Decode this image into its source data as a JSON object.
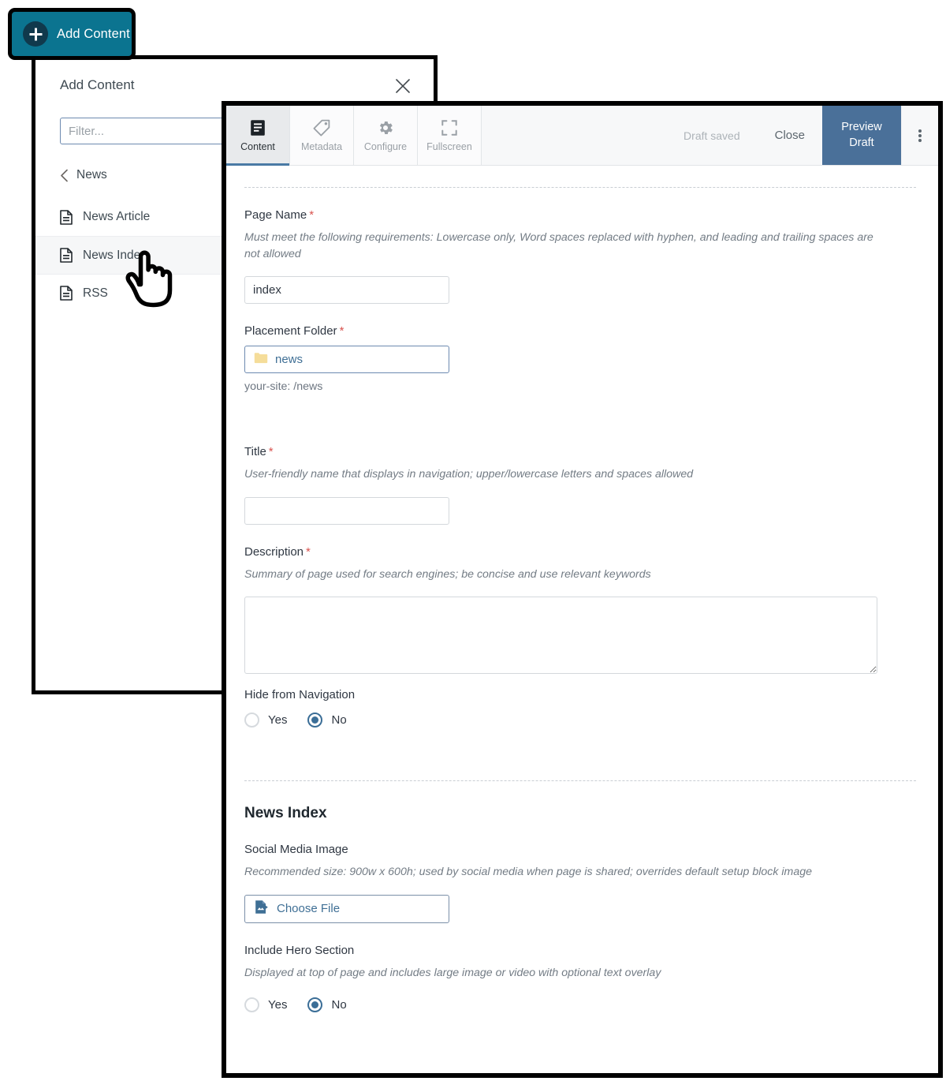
{
  "add_content_button": {
    "label": "Add Content",
    "icon": "plus-circle-icon",
    "background": "#0b7490",
    "icon_background": "#10394c"
  },
  "add_content_dialog": {
    "title": "Add Content",
    "close_icon": "close-icon",
    "filter": {
      "placeholder": "Filter...",
      "value": ""
    },
    "breadcrumb": {
      "back_icon": "chevron-left-icon",
      "label": "News"
    },
    "items": [
      {
        "label": "News Article",
        "icon": "document-icon",
        "selected": false
      },
      {
        "label": "News Index",
        "icon": "document-icon",
        "selected": true
      },
      {
        "label": "RSS",
        "icon": "document-icon",
        "selected": false
      }
    ]
  },
  "cursor": {
    "icon": "pointing-hand-cursor"
  },
  "editor": {
    "tabs": [
      {
        "label": "Content",
        "icon": "content-document-icon",
        "active": true
      },
      {
        "label": "Metadata",
        "icon": "tag-icon",
        "active": false
      },
      {
        "label": "Configure",
        "icon": "gear-icon",
        "active": false
      },
      {
        "label": "Fullscreen",
        "icon": "fullscreen-icon",
        "active": false
      }
    ],
    "status_text": "Draft saved",
    "close_label": "Close",
    "preview_label": "Preview Draft",
    "preview_color": "#4a7099",
    "kebab_icon": "more-vertical-icon",
    "form": {
      "page_name": {
        "label": "Page Name",
        "required": true,
        "help": "Must meet the following requirements: Lowercase only, Word spaces replaced with hyphen, and leading and trailing spaces are not allowed",
        "value": "index",
        "placeholder": ""
      },
      "placement_folder": {
        "label": "Placement Folder",
        "required": true,
        "icon": "folder-icon",
        "value": "news",
        "path_hint": "your-site: /news"
      },
      "title": {
        "label": "Title",
        "required": true,
        "help": "User-friendly name that displays in navigation; upper/lowercase letters and spaces allowed",
        "value": "",
        "placeholder": ""
      },
      "description": {
        "label": "Description",
        "required": true,
        "help": "Summary of page used for search engines; be concise and use relevant keywords",
        "value": "",
        "placeholder": ""
      },
      "hide_from_navigation": {
        "label": "Hide from Navigation",
        "options": [
          "Yes",
          "No"
        ],
        "selected": "No"
      },
      "section_heading": "News Index",
      "social_media_image": {
        "label": "Social Media Image",
        "help": "Recommended size: 900w x 600h; used by social media when page is shared; overrides default setup block image",
        "button_label": "Choose File",
        "button_icon": "image-file-icon"
      },
      "include_hero_section": {
        "label": "Include Hero Section",
        "help": "Displayed at top of page and includes large image or video with optional text overlay",
        "options": [
          "Yes",
          "No"
        ],
        "selected": "No"
      }
    }
  }
}
